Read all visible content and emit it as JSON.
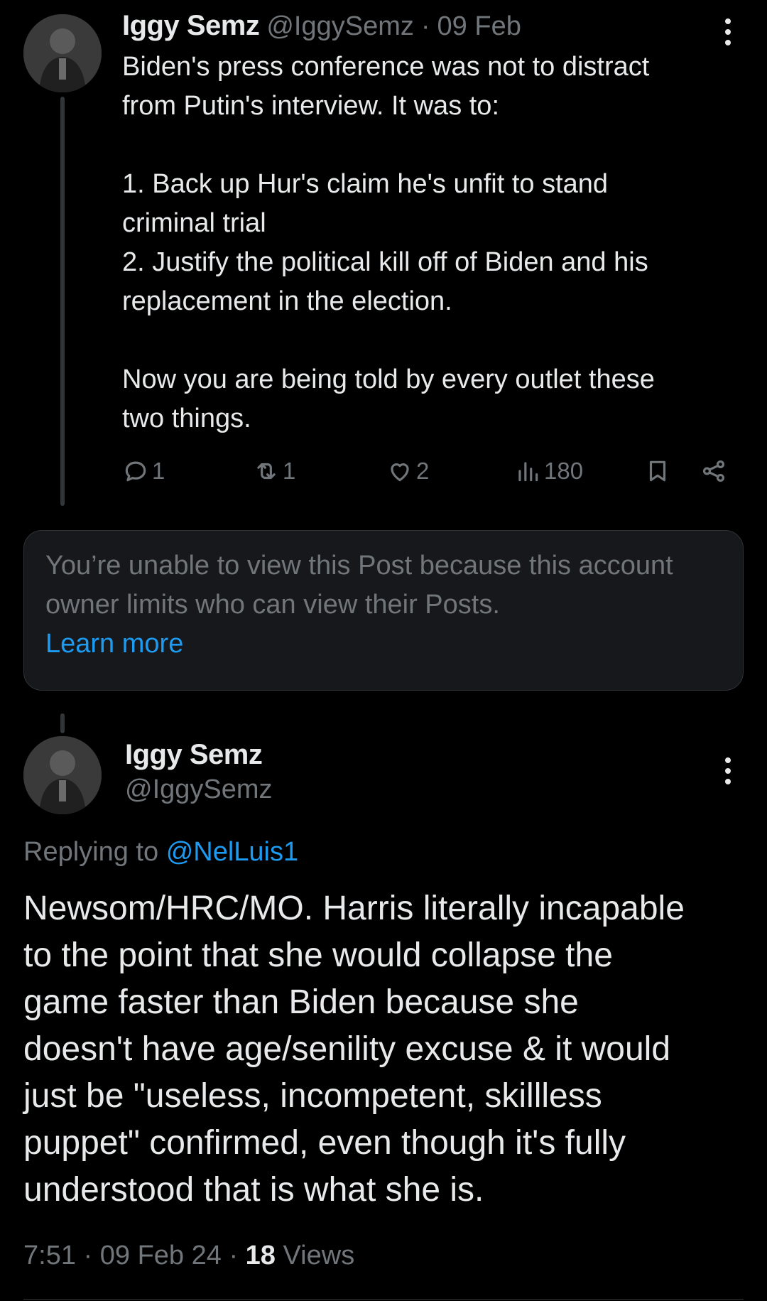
{
  "tweet1": {
    "display_name": "Iggy Semz",
    "handle": "@IggySemz",
    "separator": "·",
    "date": "09 Feb",
    "text": "Biden's press conference was not to distract\nfrom Putin's interview. It was to:\n\n1. Back up Hur's claim he's unfit to stand\ncriminal trial\n2. Justify the political kill off of Biden and his\nreplacement in the election.\n\nNow you are being told by every outlet these\ntwo things.",
    "replies": "1",
    "reposts": "1",
    "likes": "2",
    "views": "180"
  },
  "notice": {
    "text": "You’re unable to view this Post because this account owner limits who can view their Posts.",
    "link": "Learn more"
  },
  "tweet2": {
    "display_name": "Iggy Semz",
    "handle": "@IggySemz",
    "replying_label": "Replying to",
    "replying_to": "@NelLuis1",
    "text": "Newsom/HRC/MO. Harris literally incapable\nto the point that she would collapse the\ngame faster than Biden because she\ndoesn't have age/senility excuse & it would\njust be \"useless, incompetent, skillless\npuppet\" confirmed, even though it's fully\nunderstood that is what she is.",
    "time": "7:51",
    "date": "09 Feb 24",
    "views_count": "18",
    "views_label": "Views",
    "dot": "·"
  },
  "colors": {
    "background": "#000000",
    "text": "#e7e9ea",
    "muted": "#71767b",
    "link": "#1d9bf0",
    "card": "#16181c"
  }
}
